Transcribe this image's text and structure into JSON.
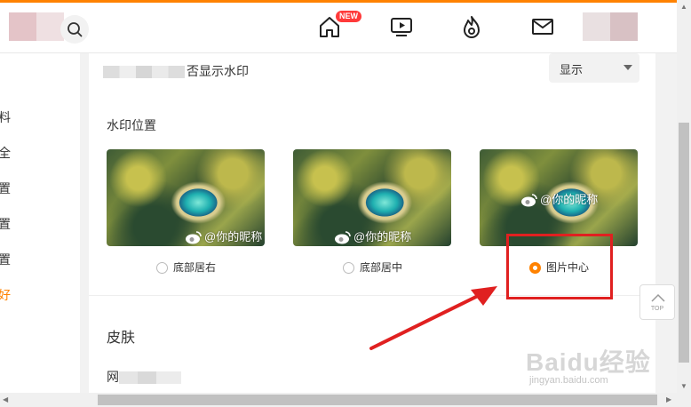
{
  "header": {
    "new_badge": "NEW",
    "icons": [
      "search-icon",
      "home-icon",
      "video-icon",
      "hot-icon",
      "mail-icon"
    ]
  },
  "sidebar": {
    "items": [
      {
        "label": "料",
        "active": false
      },
      {
        "label": "全",
        "active": false
      },
      {
        "label": "置",
        "active": false
      },
      {
        "label": "置",
        "active": false
      },
      {
        "label": "置",
        "active": false
      },
      {
        "label": "好",
        "active": true
      }
    ]
  },
  "settings": {
    "watermark_row_label": "否显示水印",
    "watermark_select_value": "显示",
    "position_section_title": "水印位置",
    "watermark_text": "@你的昵称",
    "options": [
      {
        "label": "底部居右",
        "selected": false
      },
      {
        "label": "底部居中",
        "selected": false
      },
      {
        "label": "图片中心",
        "selected": true
      }
    ],
    "skin_title": "皮肤",
    "skin_sub_prefix": "网"
  },
  "back_to_top": {
    "label": "TOP"
  },
  "overlay_watermark": {
    "brand": "Baidu经验",
    "url": "jingyan.baidu.com"
  },
  "colors": {
    "accent": "#ff8200",
    "highlight": "#e02020"
  }
}
